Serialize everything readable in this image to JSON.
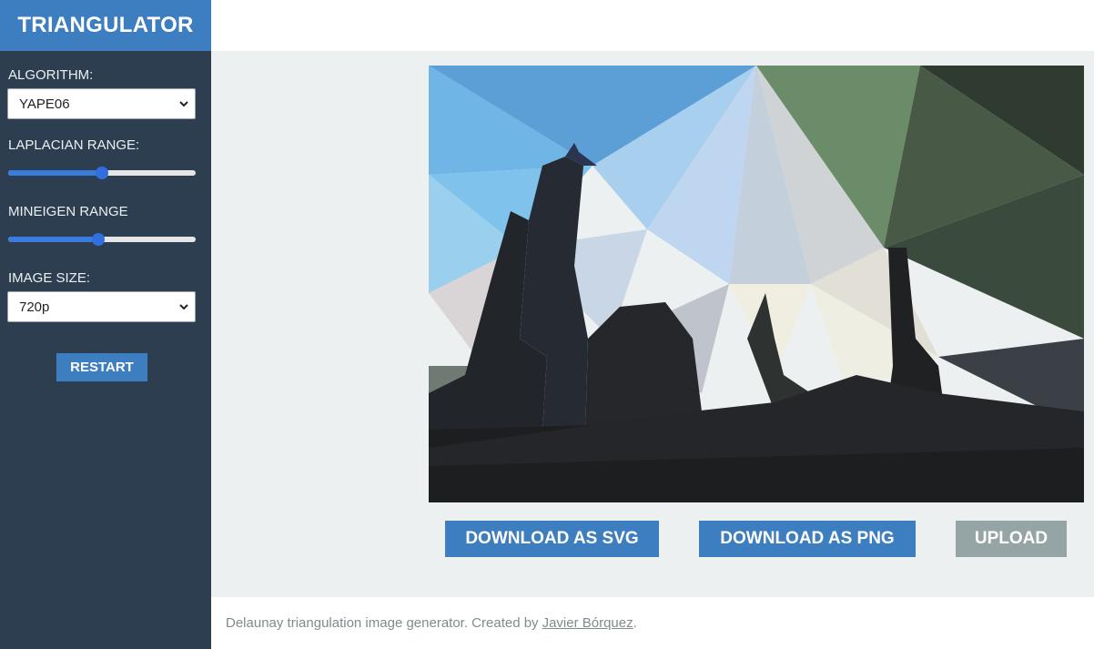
{
  "app": {
    "title": "TRIANGULATOR"
  },
  "controls": {
    "algorithm": {
      "label": "ALGORITHM:",
      "value": "YAPE06"
    },
    "laplacian": {
      "label": "LAPLACIAN RANGE:",
      "fraction": 0.5
    },
    "mineigen": {
      "label": "MINEIGEN RANGE",
      "fraction": 0.48
    },
    "image_size": {
      "label": "IMAGE SIZE:",
      "value": "720p"
    },
    "restart_label": "RESTART"
  },
  "actions": {
    "download_svg": "DOWNLOAD AS SVG",
    "download_png": "DOWNLOAD AS PNG",
    "upload": "UPLOAD"
  },
  "footer": {
    "text": "Delaunay triangulation image generator. Created by",
    "author": "Javier Bórquez",
    "period": "."
  },
  "colors": {
    "sidebar": "#2c3e50",
    "accent": "#3c7ebf",
    "upload_disabled": "#95a5a6",
    "main_bg": "#ecf0f1"
  }
}
